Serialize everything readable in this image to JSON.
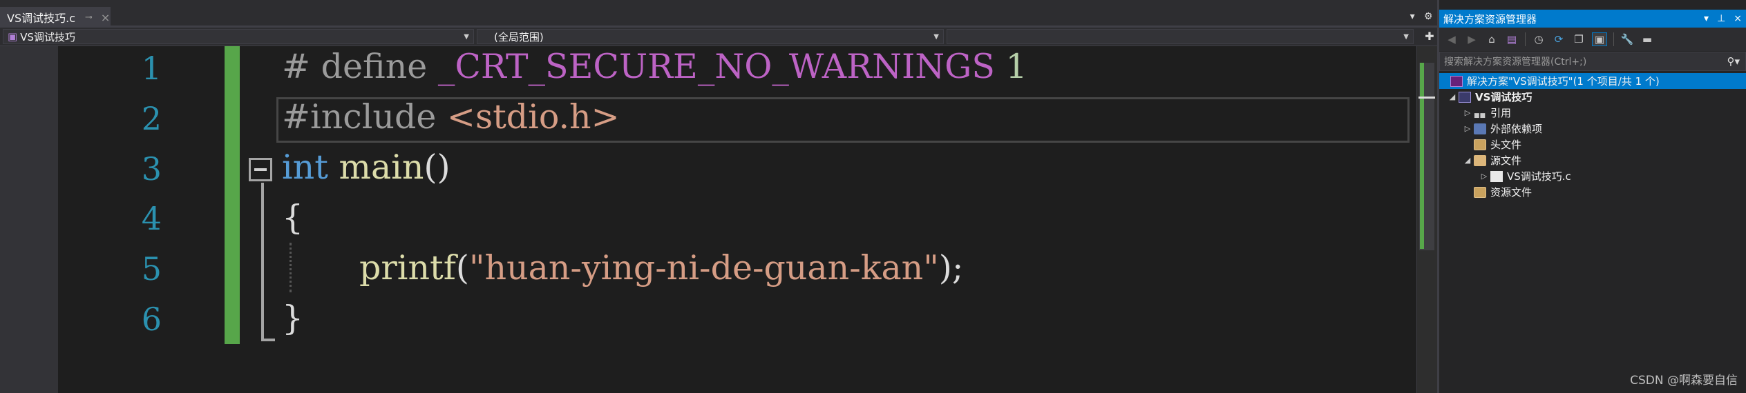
{
  "editor": {
    "tab": {
      "file_name": "VS调试技巧.c",
      "pin_icon": "pin-icon",
      "close_icon": "close-icon"
    },
    "nav": {
      "project_scope": "VS调试技巧",
      "global_scope": "(全局范围)"
    },
    "line_numbers": [
      "1",
      "2",
      "3",
      "4",
      "5",
      "6"
    ],
    "code": {
      "line1": {
        "hash": "# ",
        "define": "define ",
        "macro": "_CRT_SECURE_NO_WARNINGS ",
        "value": "1"
      },
      "line2": {
        "directive": "#include ",
        "header": "<stdio.h>"
      },
      "line3": {
        "type": "int ",
        "func": "main",
        "parens": "()"
      },
      "line4": {
        "brace": "{"
      },
      "line5": {
        "func": "printf",
        "open": "(",
        "string": "\"huan-ying-ni-de-guan-kan\"",
        "close": ");"
      },
      "line6": {
        "brace": "}"
      }
    }
  },
  "solution_explorer": {
    "title": "解决方案资源管理器",
    "search_placeholder": "搜索解决方案资源管理器(Ctrl+;)",
    "tree": {
      "solution": "解决方案\"VS调试技巧\"(1 个项目/共 1 个)",
      "project": "VS调试技巧",
      "references": "引用",
      "external_deps": "外部依赖项",
      "header_files": "头文件",
      "source_files": "源文件",
      "source_c": "VS调试技巧.c",
      "resource_files": "资源文件"
    }
  },
  "watermark": "CSDN @啊森要自信"
}
